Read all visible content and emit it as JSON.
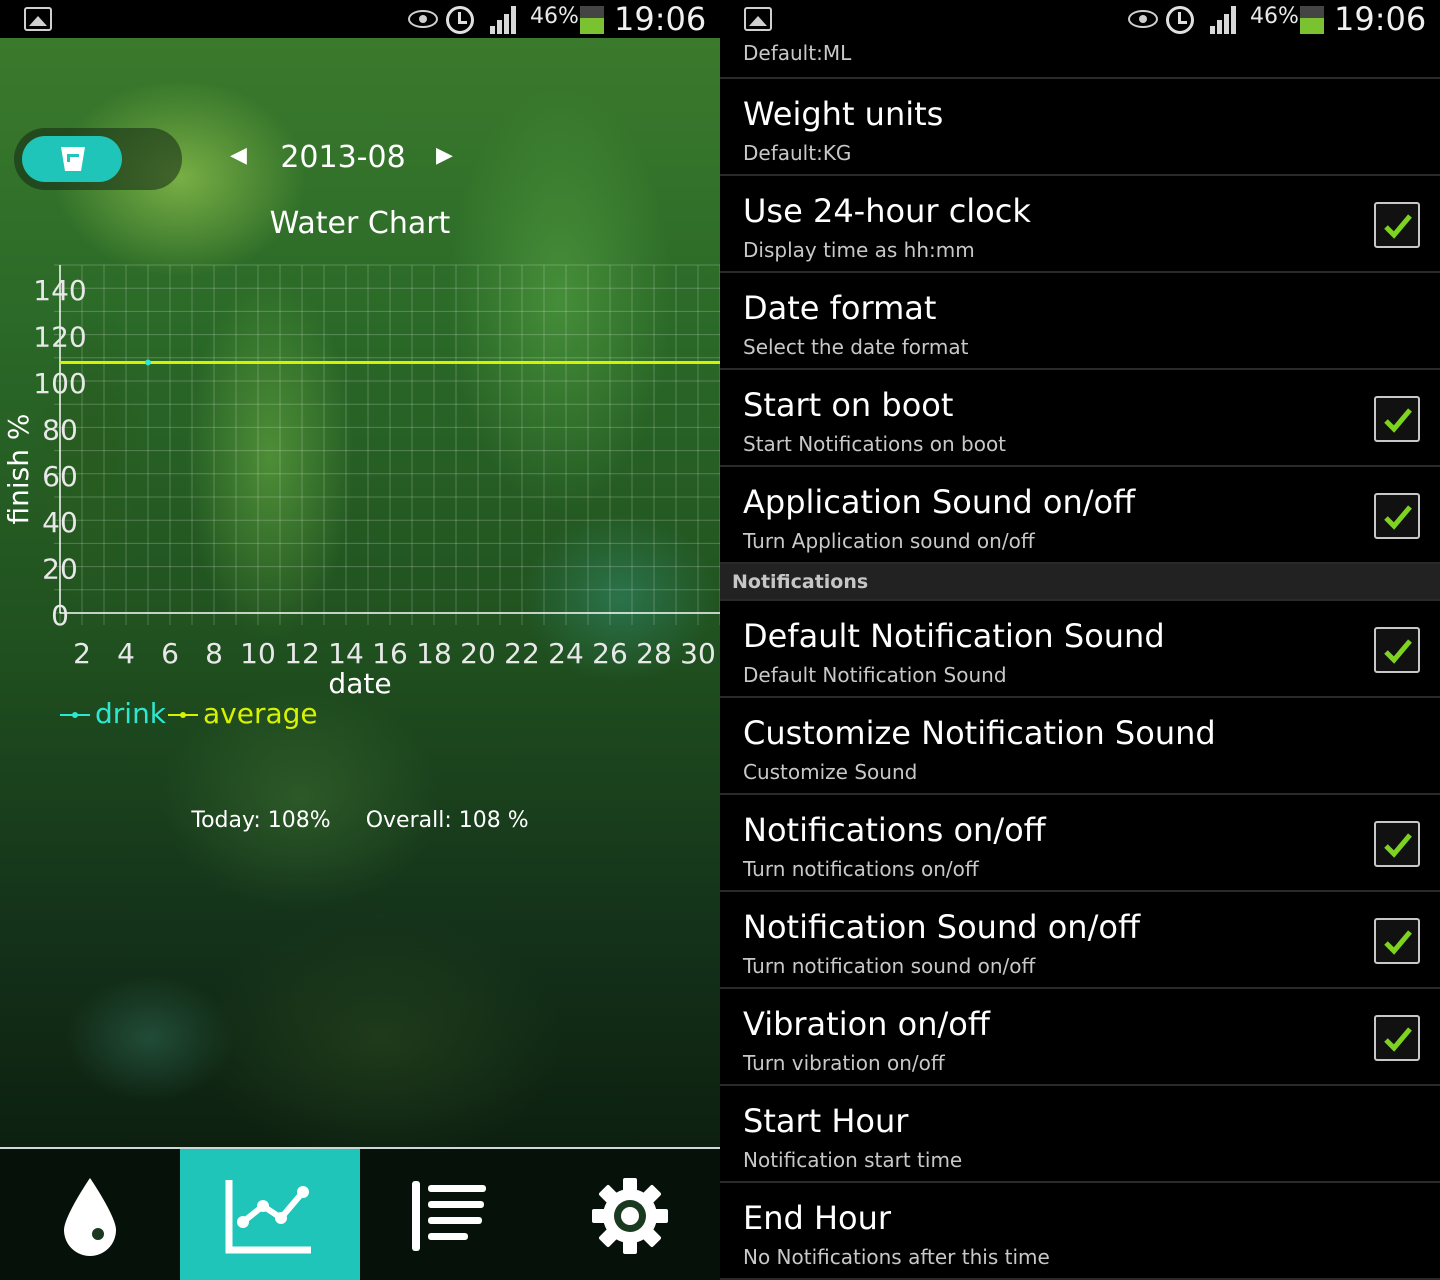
{
  "left": {
    "status": {
      "battery": "46%",
      "time": "19:06"
    },
    "month": "2013-08",
    "chart_title": "Water Chart",
    "stats": {
      "today": "Today: 108%",
      "overall": "Overall: 108 %"
    },
    "nav": [
      {
        "icon": "water-drop-icon"
      },
      {
        "icon": "chart-icon",
        "active": true
      },
      {
        "icon": "list-icon"
      },
      {
        "icon": "settings-gear-icon"
      }
    ]
  },
  "right": {
    "status": {
      "battery": "46%",
      "time": "19:06"
    },
    "rows_top": [
      {
        "title": "",
        "sub": "Default:ML",
        "checkbox": false
      },
      {
        "title": "Weight units",
        "sub": "Default:KG",
        "checkbox": false
      },
      {
        "title": "Use 24-hour clock",
        "sub": "Display time as hh:mm",
        "checkbox": true
      },
      {
        "title": "Date format",
        "sub": "Select the date format",
        "checkbox": false
      },
      {
        "title": "Start on boot",
        "sub": "Start Notifications on boot",
        "checkbox": true
      },
      {
        "title": "Application Sound on/off",
        "sub": "Turn Application sound on/off",
        "checkbox": true
      }
    ],
    "section_header": "Notifications",
    "rows_bottom": [
      {
        "title": "Default Notification Sound",
        "sub": "Default Notification Sound",
        "checkbox": true
      },
      {
        "title": "Customize Notification Sound",
        "sub": "Customize Sound",
        "checkbox": false
      },
      {
        "title": "Notifications on/off",
        "sub": "Turn notifications on/off",
        "checkbox": true
      },
      {
        "title": "Notification Sound on/off",
        "sub": "Turn notification sound on/off",
        "checkbox": true
      },
      {
        "title": "Vibration on/off",
        "sub": "Turn vibration on/off",
        "checkbox": true
      },
      {
        "title": "Start Hour",
        "sub": "Notification start time",
        "checkbox": false
      },
      {
        "title": "End Hour",
        "sub": "No Notifications after this time",
        "checkbox": false
      }
    ]
  },
  "colors": {
    "accent": "#1fc5b9",
    "average_line": "#d7f200",
    "drink_line": "#2fe6d0",
    "check": "#7ed321"
  },
  "chart_data": {
    "type": "line",
    "title": "Water Chart",
    "xlabel": "date",
    "ylabel": "finish %",
    "xlim": [
      1,
      31
    ],
    "ylim": [
      0,
      150
    ],
    "x_ticks": [
      2,
      4,
      6,
      8,
      10,
      12,
      14,
      16,
      18,
      20,
      22,
      24,
      26,
      28,
      30
    ],
    "y_ticks": [
      0,
      20,
      40,
      60,
      80,
      100,
      120,
      140
    ],
    "grid": true,
    "legend": "bottom-left",
    "series": [
      {
        "name": "drink",
        "x": [
          5
        ],
        "y": [
          108
        ]
      },
      {
        "name": "average",
        "x": [
          1,
          31
        ],
        "y": [
          108,
          108
        ]
      }
    ]
  }
}
